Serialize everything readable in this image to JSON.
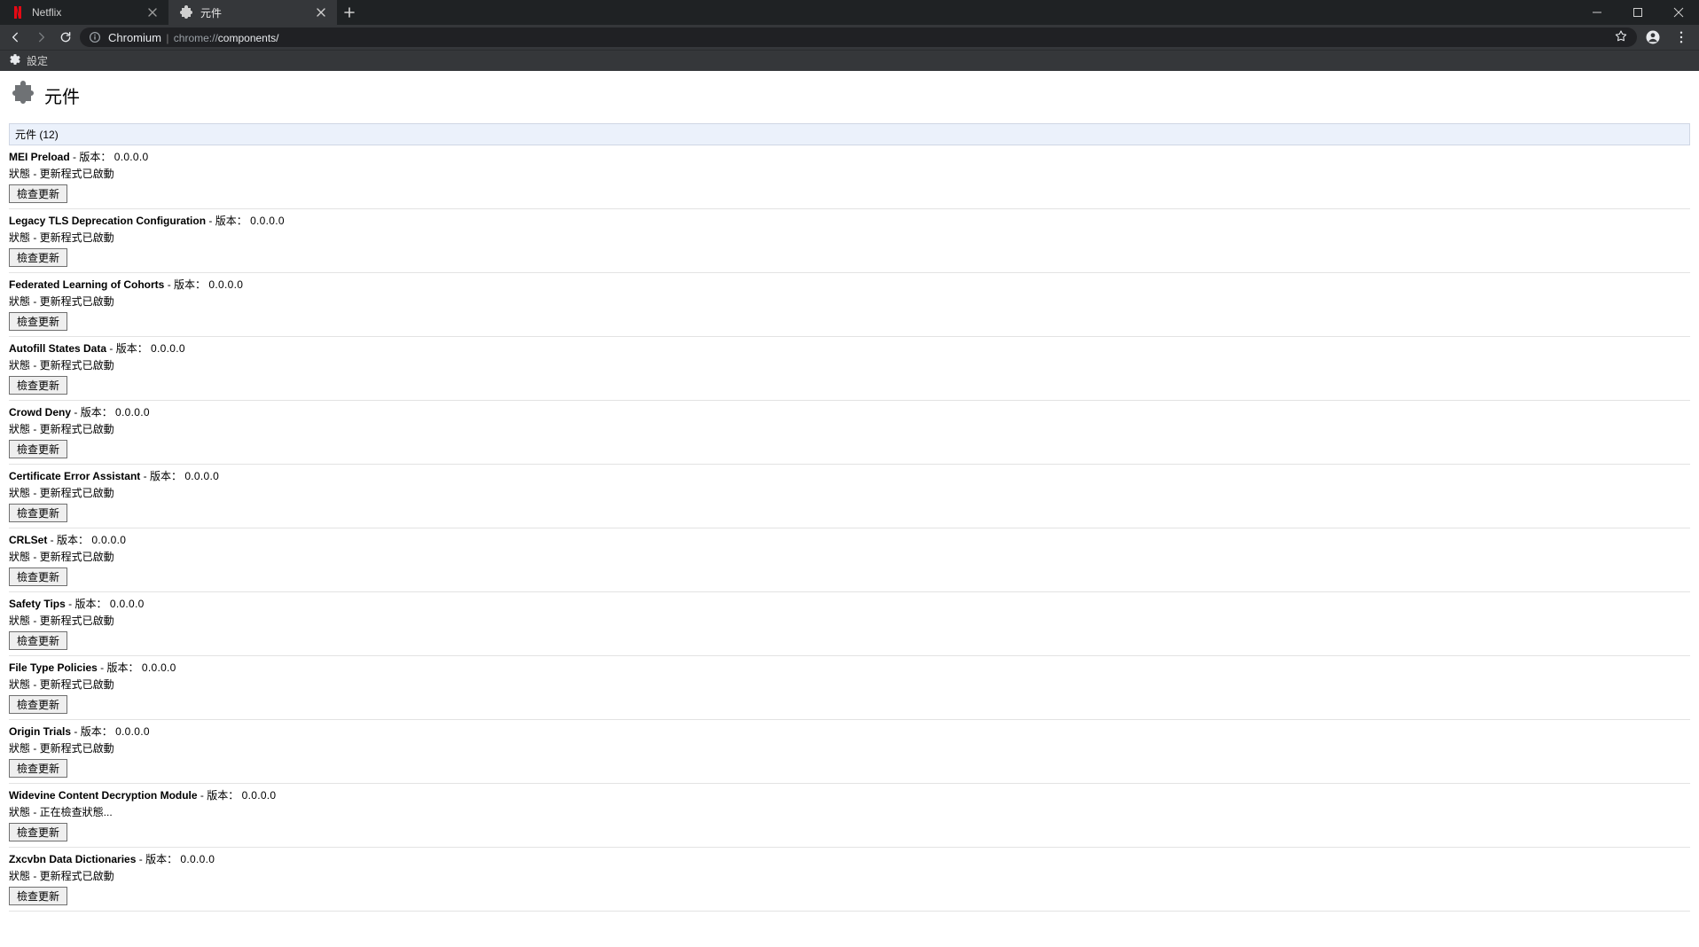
{
  "window": {
    "tabs": [
      {
        "title": "Netflix",
        "active": false
      },
      {
        "title": "元件",
        "active": true
      }
    ]
  },
  "omnibox": {
    "origin": "Chromium",
    "path_prefix": "chrome://",
    "path_highlight": "components/"
  },
  "bookmarks": {
    "settings_label": "設定"
  },
  "page": {
    "title": "元件",
    "summary_prefix": "元件",
    "summary_count": "(12)",
    "version_label": "版本：",
    "status_label": "狀態 - ",
    "check_button_label": "檢查更新",
    "status_started": "更新程式已啟動",
    "status_checking": "正在檢查狀態...",
    "components": [
      {
        "name": "MEI Preload",
        "version": "0.0.0.0",
        "status_key": "started"
      },
      {
        "name": "Legacy TLS Deprecation Configuration",
        "version": "0.0.0.0",
        "status_key": "started"
      },
      {
        "name": "Federated Learning of Cohorts",
        "version": "0.0.0.0",
        "status_key": "started"
      },
      {
        "name": "Autofill States Data",
        "version": "0.0.0.0",
        "status_key": "started"
      },
      {
        "name": "Crowd Deny",
        "version": "0.0.0.0",
        "status_key": "started"
      },
      {
        "name": "Certificate Error Assistant",
        "version": "0.0.0.0",
        "status_key": "started"
      },
      {
        "name": "CRLSet",
        "version": "0.0.0.0",
        "status_key": "started"
      },
      {
        "name": "Safety Tips",
        "version": "0.0.0.0",
        "status_key": "started"
      },
      {
        "name": "File Type Policies",
        "version": "0.0.0.0",
        "status_key": "started"
      },
      {
        "name": "Origin Trials",
        "version": "0.0.0.0",
        "status_key": "started"
      },
      {
        "name": "Widevine Content Decryption Module",
        "version": "0.0.0.0",
        "status_key": "checking"
      },
      {
        "name": "Zxcvbn Data Dictionaries",
        "version": "0.0.0.0",
        "status_key": "started"
      }
    ]
  }
}
